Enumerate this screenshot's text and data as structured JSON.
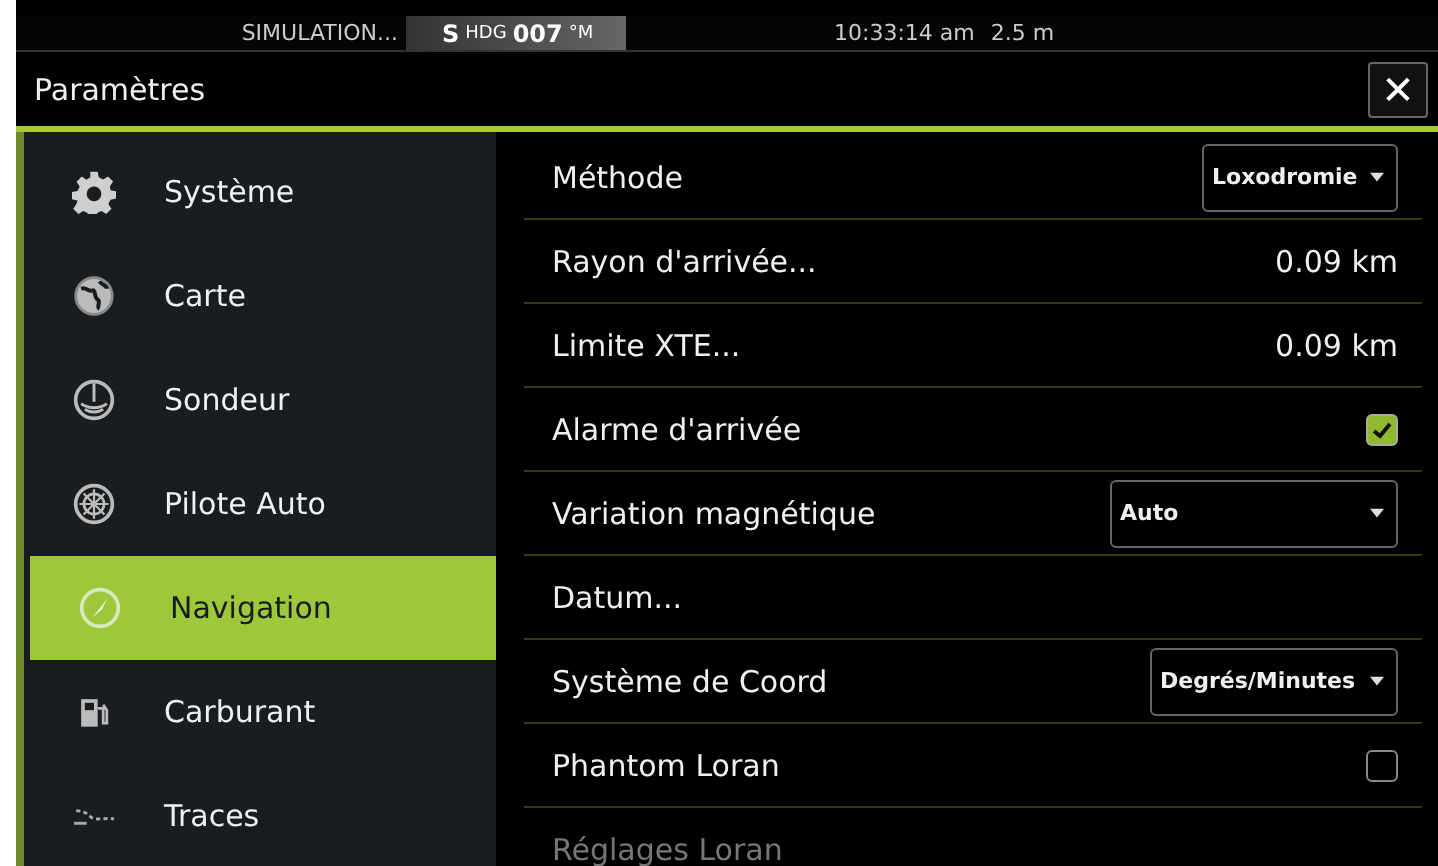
{
  "status_bar": {
    "mode": "SIMULATION...",
    "heading_prefix": "S",
    "heading_label": "HDG",
    "heading_value": "007",
    "heading_unit": "°M",
    "time": "10:33:14 am",
    "depth": "2.5 m"
  },
  "window": {
    "title": "Paramètres",
    "close": "✕"
  },
  "sidebar": {
    "items": [
      {
        "label": "Système",
        "selected": false
      },
      {
        "label": "Carte",
        "selected": false
      },
      {
        "label": "Sondeur",
        "selected": false
      },
      {
        "label": "Pilote Auto",
        "selected": false
      },
      {
        "label": "Navigation",
        "selected": true
      },
      {
        "label": "Carburant",
        "selected": false
      },
      {
        "label": "Traces",
        "selected": false
      }
    ]
  },
  "settings": [
    {
      "kind": "select",
      "label": "Méthode",
      "value": "Loxodromie"
    },
    {
      "kind": "value",
      "label": "Rayon d'arrivée...",
      "value": "0.09 km"
    },
    {
      "kind": "value",
      "label": "Limite XTE...",
      "value": "0.09 km"
    },
    {
      "kind": "checkbox",
      "label": "Alarme d'arrivée",
      "checked": true
    },
    {
      "kind": "select",
      "label": "Variation magnétique",
      "value": "Auto"
    },
    {
      "kind": "link",
      "label": "Datum...",
      "disabled": false
    },
    {
      "kind": "select",
      "label": "Système de Coord",
      "value": "Degrés/Minutes"
    },
    {
      "kind": "checkbox",
      "label": "Phantom Loran",
      "checked": false
    },
    {
      "kind": "link",
      "label": "Réglages Loran",
      "disabled": true
    }
  ]
}
